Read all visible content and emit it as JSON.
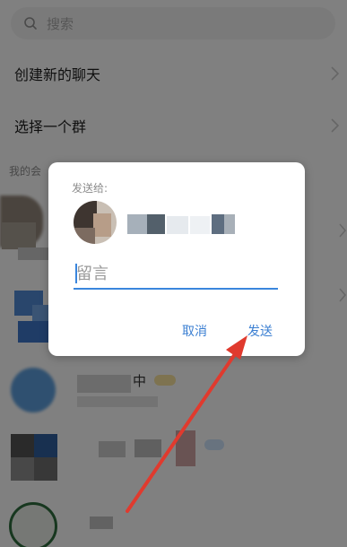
{
  "search": {
    "placeholder": "搜索"
  },
  "menu": {
    "new_chat": "创建新的聊天",
    "select_group": "选择一个群"
  },
  "section": {
    "label": "我的会"
  },
  "contacts": {
    "c3_suffix": "中"
  },
  "dialog": {
    "title": "发送给:",
    "message_placeholder": "留言",
    "cancel_label": "取消",
    "send_label": "发送"
  },
  "colors": {
    "accent": "#3a86dd",
    "button_text": "#3b7fd2",
    "arrow": "#e03a2e",
    "overlay": "rgba(0,0,0,0.48)"
  }
}
